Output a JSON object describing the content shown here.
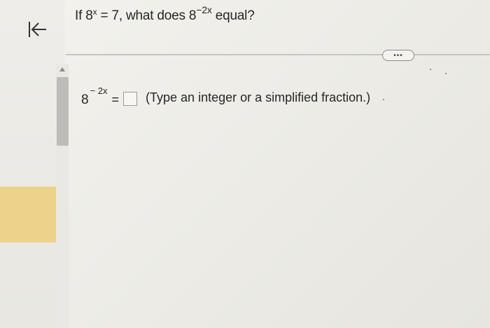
{
  "question": {
    "prefix": "If 8",
    "exp1": "x",
    "middle": " = 7, what does 8",
    "exp2": "−2x",
    "suffix": " equal?"
  },
  "answer": {
    "base": "8",
    "exponent": "− 2x",
    "equals": "=",
    "input_value": "",
    "hint": "(Type an integer or a simplified fraction.)"
  },
  "more_button": {
    "label": "•••"
  },
  "icons": {
    "back": "back-to-start-arrow-icon",
    "scroll_up": "scroll-up-arrow-icon"
  },
  "colors": {
    "highlight": "#ecd28a",
    "scroll_thumb": "#bdbcb8",
    "text": "#262626"
  }
}
